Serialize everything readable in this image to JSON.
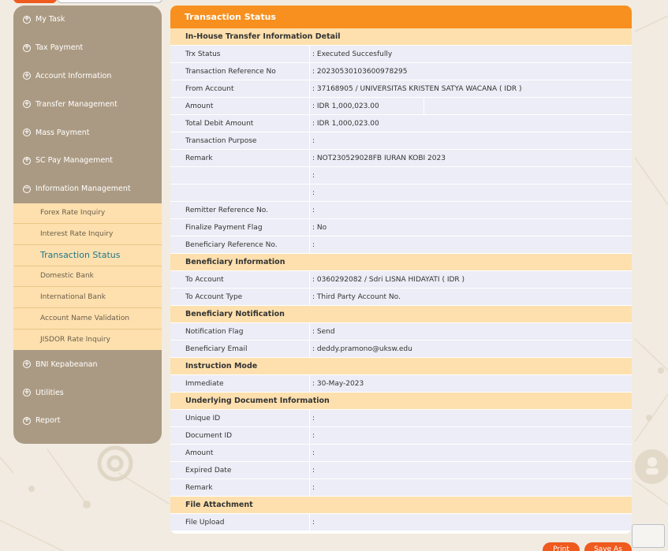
{
  "sidebar": {
    "items_top": [
      {
        "label": "My Task"
      },
      {
        "label": "Tax Payment"
      },
      {
        "label": "Account Information"
      },
      {
        "label": "Transfer Management"
      },
      {
        "label": "Mass Payment"
      },
      {
        "label": "SC Pay Management"
      },
      {
        "label": "Information Management"
      }
    ],
    "submenu": [
      {
        "label": "Forex Rate Inquiry"
      },
      {
        "label": "Interest Rate Inquiry"
      },
      {
        "label": "Transaction Status"
      },
      {
        "label": "Domestic Bank"
      },
      {
        "label": "International Bank"
      },
      {
        "label": "Account Name Validation"
      },
      {
        "label": "JISDOR Rate Inquiry"
      }
    ],
    "items_bottom": [
      {
        "label": "BNI Kepabeanan"
      },
      {
        "label": "Utilities"
      },
      {
        "label": "Report"
      }
    ],
    "plus_symbol": "+",
    "minus_symbol": "−"
  },
  "panel": {
    "title": "Transaction Status",
    "sections": {
      "inhouse": "In-House Transfer Information Detail",
      "beneficiary": "Beneficiary Information",
      "notification": "Beneficiary Notification",
      "instruction": "Instruction Mode",
      "underlying": "Underlying Document Information",
      "attachment": "File Attachment"
    },
    "rows": {
      "trx_status": {
        "label": "Trx Status",
        "value": ": Executed Succesfully"
      },
      "trx_ref": {
        "label": "Transaction Reference No",
        "value": ": 20230530103600978295"
      },
      "from_account": {
        "label": "From Account",
        "value": ": 37168905 / UNIVERSITAS KRISTEN SATYA WACANA ( IDR )"
      },
      "amount": {
        "label": "Amount",
        "value": ": IDR  1,000,023.00"
      },
      "total_debit": {
        "label": "Total Debit Amount",
        "value": ": IDR  1,000,023.00"
      },
      "purpose": {
        "label": "Transaction Purpose",
        "value": ":"
      },
      "remark": {
        "label": "Remark",
        "value": ": NOT230529028FB IURAN KOBI 2023"
      },
      "remark2": {
        "label": "",
        "value": ":"
      },
      "remark3": {
        "label": "",
        "value": ":"
      },
      "remitter_ref": {
        "label": "Remitter Reference No.",
        "value": ":"
      },
      "finalize_flag": {
        "label": "Finalize Payment Flag",
        "value": ": No"
      },
      "beneficiary_ref": {
        "label": "Beneficiary Reference No.",
        "value": ":"
      },
      "to_account": {
        "label": "To Account",
        "value": ": 0360292082 / Sdri LISNA HIDAYATI ( IDR )"
      },
      "to_account_type": {
        "label": "To Account Type",
        "value": ": Third Party Account No."
      },
      "notif_flag": {
        "label": "Notification Flag",
        "value": ": Send"
      },
      "beneficiary_email": {
        "label": "Beneficiary Email",
        "value": ": deddy.pramono@uksw.edu"
      },
      "immediate": {
        "label": "Immediate",
        "value": ": 30-May-2023"
      },
      "unique_id": {
        "label": "Unique ID",
        "value": ":"
      },
      "document_id": {
        "label": "Document ID",
        "value": ":"
      },
      "doc_amount": {
        "label": "Amount",
        "value": ":"
      },
      "expired_date": {
        "label": "Expired Date",
        "value": ":"
      },
      "doc_remark": {
        "label": "Remark",
        "value": ":"
      },
      "file_upload": {
        "label": "File Upload",
        "value": ":"
      }
    }
  },
  "buttons": {
    "print": "Print",
    "save_as": "Save As"
  },
  "colors": {
    "header_orange": "#f7901e",
    "section_bg": "#fde0ae",
    "row_bg": "#ecedf6",
    "sidebar_bg": "#ab9a83",
    "active_link": "#1d7789",
    "button_orange": "#ef5a1f"
  }
}
